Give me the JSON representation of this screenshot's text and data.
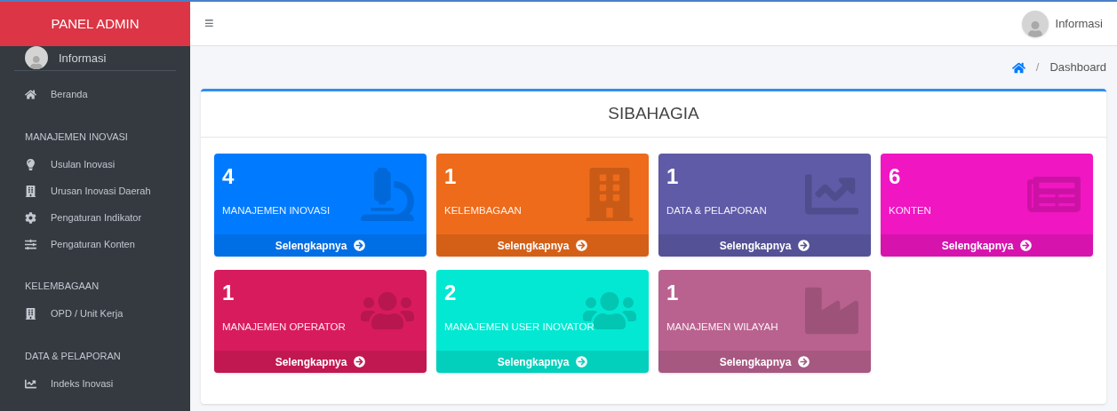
{
  "sidebar": {
    "brand": "PANEL ADMIN",
    "user": "Informasi",
    "sections": [
      {
        "items": [
          "Beranda"
        ]
      },
      {
        "heading": "MANAJEMEN INOVASI",
        "items": [
          "Usulan Inovasi",
          "Urusan Inovasi Daerah",
          "Pengaturan Indikator",
          "Pengaturan Konten"
        ]
      },
      {
        "heading": "KELEMBAGAAN",
        "items": [
          "OPD / Unit Kerja"
        ]
      },
      {
        "heading": "DATA & PELAPORAN",
        "items": [
          "Indeks Inovasi"
        ]
      }
    ]
  },
  "topbar": {
    "menu": "≡",
    "user": "Informasi"
  },
  "breadcrumb": {
    "separator": "/",
    "items": [
      "Dashboard"
    ]
  },
  "panel": {
    "title": "SIBAHAGIA",
    "tiles": [
      {
        "count": "4",
        "label": "MANAJEMEN INOVASI",
        "link": "Selengkapnya",
        "color": "#007bff"
      },
      {
        "count": "1",
        "label": "KELEMBAGAAN",
        "link": "Selengkapnya",
        "color": "#ed6b1b"
      },
      {
        "count": "1",
        "label": "DATA & PELAPORAN",
        "link": "Selengkapnya",
        "color": "#5f5ba7"
      },
      {
        "count": "6",
        "label": "KONTEN",
        "link": "Selengkapnya",
        "color": "#f016c2"
      },
      {
        "count": "1",
        "label": "MANAJEMEN OPERATOR",
        "link": "Selengkapnya",
        "color": "#d81b5c"
      },
      {
        "count": "2",
        "label": "MANAJEMEN USER INOVATOR",
        "link": "Selengkapnya",
        "color": "#03e8d2"
      },
      {
        "count": "1",
        "label": "MANAJEMEN WILAYAH",
        "link": "Selengkapnya",
        "color": "#b9628f"
      }
    ]
  }
}
